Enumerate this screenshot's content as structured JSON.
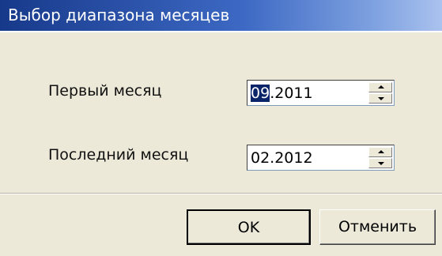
{
  "window": {
    "title": "Выбор диапазона месяцев"
  },
  "form": {
    "first_month": {
      "label": "Первый месяц",
      "value_selected": "09",
      "value_rest": ".2011"
    },
    "last_month": {
      "label": "Последний месяц",
      "value": "02.2012"
    }
  },
  "buttons": {
    "ok": "OK",
    "cancel": "Отменить"
  },
  "colors": {
    "title_bar_start": "#17398a",
    "title_bar_end": "#aac2ee",
    "selection": "#0a246a",
    "face": "#ece9d8"
  }
}
